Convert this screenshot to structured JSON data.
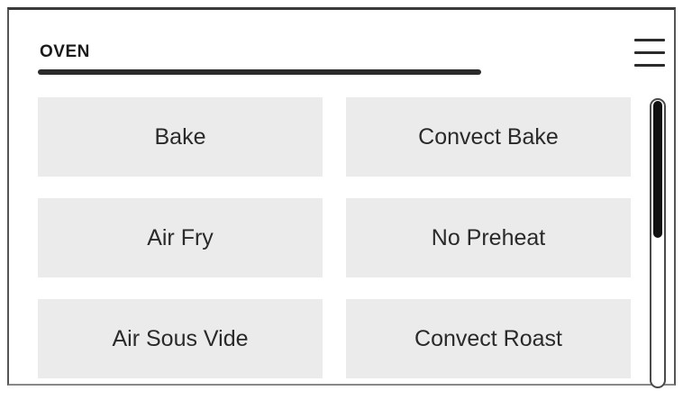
{
  "header": {
    "title": "OVEN",
    "menu_icon": "hamburger-menu-icon"
  },
  "modes": [
    {
      "label": "Bake"
    },
    {
      "label": "Convect Bake"
    },
    {
      "label": "Air Fry"
    },
    {
      "label": "No Preheat"
    },
    {
      "label": "Air Sous Vide"
    },
    {
      "label": "Convect Roast"
    }
  ],
  "colors": {
    "tile_background": "#ebebeb",
    "text": "#2a2a2a",
    "accent_dark": "#2b2b2b"
  },
  "scroll": {
    "visible_fraction": 0.47,
    "position_fraction": 0.0
  }
}
